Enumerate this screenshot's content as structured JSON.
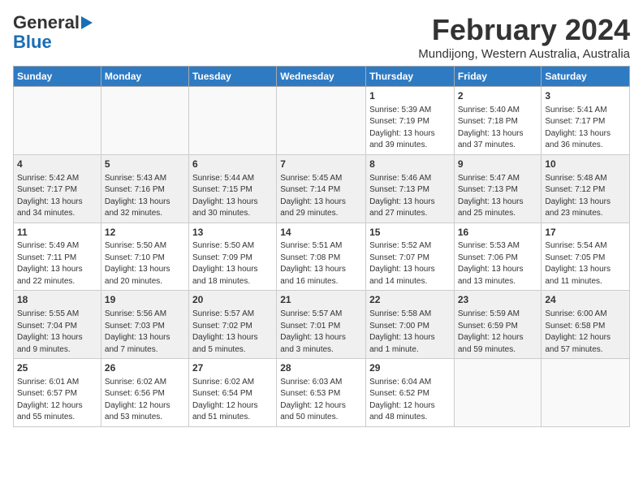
{
  "logo": {
    "line1": "General",
    "line2": "Blue"
  },
  "title": "February 2024",
  "location": "Mundijong, Western Australia, Australia",
  "days_of_week": [
    "Sunday",
    "Monday",
    "Tuesday",
    "Wednesday",
    "Thursday",
    "Friday",
    "Saturday"
  ],
  "weeks": [
    [
      {
        "day": "",
        "text": ""
      },
      {
        "day": "",
        "text": ""
      },
      {
        "day": "",
        "text": ""
      },
      {
        "day": "",
        "text": ""
      },
      {
        "day": "1",
        "text": "Sunrise: 5:39 AM\nSunset: 7:19 PM\nDaylight: 13 hours\nand 39 minutes."
      },
      {
        "day": "2",
        "text": "Sunrise: 5:40 AM\nSunset: 7:18 PM\nDaylight: 13 hours\nand 37 minutes."
      },
      {
        "day": "3",
        "text": "Sunrise: 5:41 AM\nSunset: 7:17 PM\nDaylight: 13 hours\nand 36 minutes."
      }
    ],
    [
      {
        "day": "4",
        "text": "Sunrise: 5:42 AM\nSunset: 7:17 PM\nDaylight: 13 hours\nand 34 minutes."
      },
      {
        "day": "5",
        "text": "Sunrise: 5:43 AM\nSunset: 7:16 PM\nDaylight: 13 hours\nand 32 minutes."
      },
      {
        "day": "6",
        "text": "Sunrise: 5:44 AM\nSunset: 7:15 PM\nDaylight: 13 hours\nand 30 minutes."
      },
      {
        "day": "7",
        "text": "Sunrise: 5:45 AM\nSunset: 7:14 PM\nDaylight: 13 hours\nand 29 minutes."
      },
      {
        "day": "8",
        "text": "Sunrise: 5:46 AM\nSunset: 7:13 PM\nDaylight: 13 hours\nand 27 minutes."
      },
      {
        "day": "9",
        "text": "Sunrise: 5:47 AM\nSunset: 7:13 PM\nDaylight: 13 hours\nand 25 minutes."
      },
      {
        "day": "10",
        "text": "Sunrise: 5:48 AM\nSunset: 7:12 PM\nDaylight: 13 hours\nand 23 minutes."
      }
    ],
    [
      {
        "day": "11",
        "text": "Sunrise: 5:49 AM\nSunset: 7:11 PM\nDaylight: 13 hours\nand 22 minutes."
      },
      {
        "day": "12",
        "text": "Sunrise: 5:50 AM\nSunset: 7:10 PM\nDaylight: 13 hours\nand 20 minutes."
      },
      {
        "day": "13",
        "text": "Sunrise: 5:50 AM\nSunset: 7:09 PM\nDaylight: 13 hours\nand 18 minutes."
      },
      {
        "day": "14",
        "text": "Sunrise: 5:51 AM\nSunset: 7:08 PM\nDaylight: 13 hours\nand 16 minutes."
      },
      {
        "day": "15",
        "text": "Sunrise: 5:52 AM\nSunset: 7:07 PM\nDaylight: 13 hours\nand 14 minutes."
      },
      {
        "day": "16",
        "text": "Sunrise: 5:53 AM\nSunset: 7:06 PM\nDaylight: 13 hours\nand 13 minutes."
      },
      {
        "day": "17",
        "text": "Sunrise: 5:54 AM\nSunset: 7:05 PM\nDaylight: 13 hours\nand 11 minutes."
      }
    ],
    [
      {
        "day": "18",
        "text": "Sunrise: 5:55 AM\nSunset: 7:04 PM\nDaylight: 13 hours\nand 9 minutes."
      },
      {
        "day": "19",
        "text": "Sunrise: 5:56 AM\nSunset: 7:03 PM\nDaylight: 13 hours\nand 7 minutes."
      },
      {
        "day": "20",
        "text": "Sunrise: 5:57 AM\nSunset: 7:02 PM\nDaylight: 13 hours\nand 5 minutes."
      },
      {
        "day": "21",
        "text": "Sunrise: 5:57 AM\nSunset: 7:01 PM\nDaylight: 13 hours\nand 3 minutes."
      },
      {
        "day": "22",
        "text": "Sunrise: 5:58 AM\nSunset: 7:00 PM\nDaylight: 13 hours\nand 1 minute."
      },
      {
        "day": "23",
        "text": "Sunrise: 5:59 AM\nSunset: 6:59 PM\nDaylight: 12 hours\nand 59 minutes."
      },
      {
        "day": "24",
        "text": "Sunrise: 6:00 AM\nSunset: 6:58 PM\nDaylight: 12 hours\nand 57 minutes."
      }
    ],
    [
      {
        "day": "25",
        "text": "Sunrise: 6:01 AM\nSunset: 6:57 PM\nDaylight: 12 hours\nand 55 minutes."
      },
      {
        "day": "26",
        "text": "Sunrise: 6:02 AM\nSunset: 6:56 PM\nDaylight: 12 hours\nand 53 minutes."
      },
      {
        "day": "27",
        "text": "Sunrise: 6:02 AM\nSunset: 6:54 PM\nDaylight: 12 hours\nand 51 minutes."
      },
      {
        "day": "28",
        "text": "Sunrise: 6:03 AM\nSunset: 6:53 PM\nDaylight: 12 hours\nand 50 minutes."
      },
      {
        "day": "29",
        "text": "Sunrise: 6:04 AM\nSunset: 6:52 PM\nDaylight: 12 hours\nand 48 minutes."
      },
      {
        "day": "",
        "text": ""
      },
      {
        "day": "",
        "text": ""
      }
    ]
  ]
}
